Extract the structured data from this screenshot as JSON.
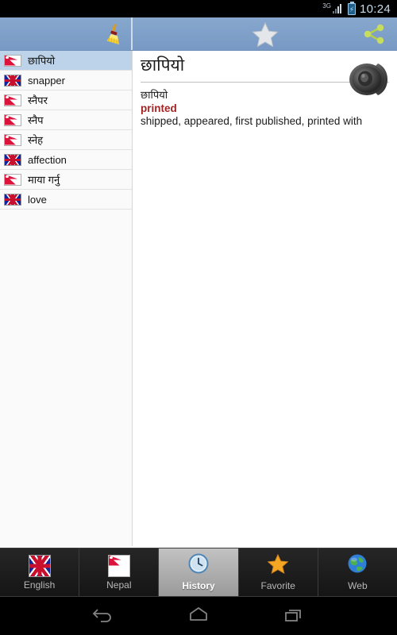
{
  "status_bar": {
    "network_label": "3G",
    "time": "10:24",
    "signal_icon": "signal-bars-icon",
    "battery_icon": "battery-charging-icon"
  },
  "action_bar": {
    "clear_button_label": "Clear history",
    "clear_icon": "broom-icon",
    "favorite_icon": "star-icon",
    "share_icon": "share-icon",
    "background_color": "#7ea0c9"
  },
  "history_list": {
    "items": [
      {
        "flag": "nepal-flag-icon",
        "lang": "np",
        "label": "छापियो",
        "selected": true
      },
      {
        "flag": "uk-flag-icon",
        "lang": "uk",
        "label": "snapper",
        "selected": false
      },
      {
        "flag": "nepal-flag-icon",
        "lang": "np",
        "label": "स्नैपर",
        "selected": false
      },
      {
        "flag": "nepal-flag-icon",
        "lang": "np",
        "label": "स्नैप",
        "selected": false
      },
      {
        "flag": "nepal-flag-icon",
        "lang": "np",
        "label": "स्नेह",
        "selected": false
      },
      {
        "flag": "uk-flag-icon",
        "lang": "uk",
        "label": "affection",
        "selected": false
      },
      {
        "flag": "nepal-flag-icon",
        "lang": "np",
        "label": "माया गर्नु",
        "selected": false
      },
      {
        "flag": "uk-flag-icon",
        "lang": "uk",
        "label": "love",
        "selected": false
      }
    ]
  },
  "detail": {
    "headword": "छापियो",
    "source_word": "छापियो",
    "translation": "printed",
    "synonyms": "shipped, appeared, first published, printed with",
    "speaker_icon": "speaker-icon",
    "translation_color": "#a12525"
  },
  "tab_bar": {
    "tabs": [
      {
        "label": "English",
        "icon": "uk-flag-icon",
        "active": false
      },
      {
        "label": "Nepal",
        "icon": "nepal-flag-icon",
        "active": false
      },
      {
        "label": "History",
        "icon": "clock-icon",
        "active": true
      },
      {
        "label": "Favorite",
        "icon": "star-icon",
        "active": false
      },
      {
        "label": "Web",
        "icon": "globe-icon",
        "active": false
      }
    ]
  },
  "nav_bar": {
    "back_label": "Back",
    "home_label": "Home",
    "recents_label": "Recent apps"
  }
}
